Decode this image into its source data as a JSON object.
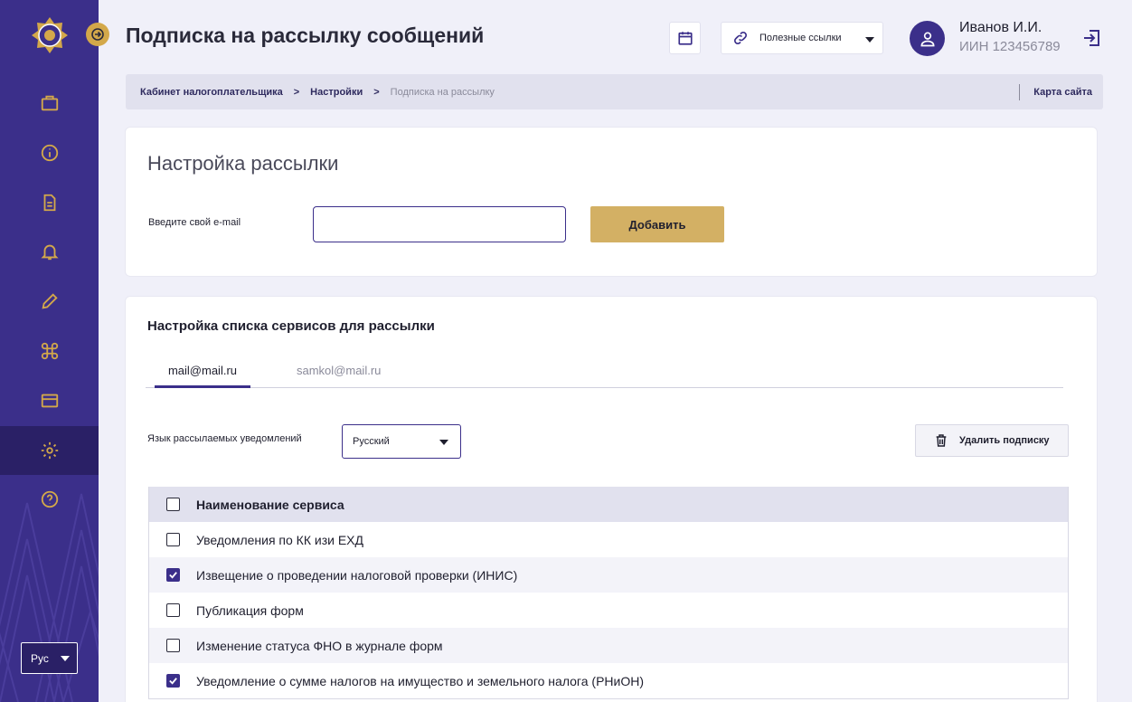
{
  "header": {
    "title": "Подписка на рассылку сообщений",
    "links_label": "Полезные ссылки",
    "user_name": "Иванов И.И.",
    "user_iin": "ИИН 123456789"
  },
  "breadcrumb": {
    "items": [
      "Кабинет налогоплательщика",
      "Настройки"
    ],
    "separator": ">",
    "current": "Подписка на рассылку",
    "sitemap": "Карта сайта"
  },
  "sidebar": {
    "icons": [
      "briefcase-icon",
      "info-icon",
      "document-icon",
      "bell-icon",
      "pencil-icon",
      "command-icon",
      "card-icon",
      "gear-icon",
      "help-icon"
    ],
    "active": "gear-icon",
    "language": "Рус"
  },
  "mailing": {
    "title": "Настройка рассылки",
    "email_label": "Введите свой e-mail",
    "email_value": "",
    "add_button": "Добавить"
  },
  "services": {
    "title": "Настройка списка сервисов для рассылки",
    "tabs": [
      "mail@mail.ru",
      "samkol@mail.ru"
    ],
    "active_tab": 0,
    "language_label": "Язык рассылаемых уведомлений",
    "language_value": "Русский",
    "delete_button": "Удалить подписку",
    "table_header": "Наименование сервиса",
    "rows": [
      {
        "name": "Уведомления по КК изи ЕХД",
        "checked": false
      },
      {
        "name": "Извещение о проведении налоговой проверки (ИНИС)",
        "checked": true
      },
      {
        "name": "Публикация форм",
        "checked": false
      },
      {
        "name": "Изменение статуса ФНО в журнале форм",
        "checked": false
      },
      {
        "name": "Уведомление о сумме налогов на имущество и земельного налога (РНиОН)",
        "checked": true
      }
    ]
  },
  "colors": {
    "primary": "#3b2f8a",
    "accent": "#d3b064"
  }
}
